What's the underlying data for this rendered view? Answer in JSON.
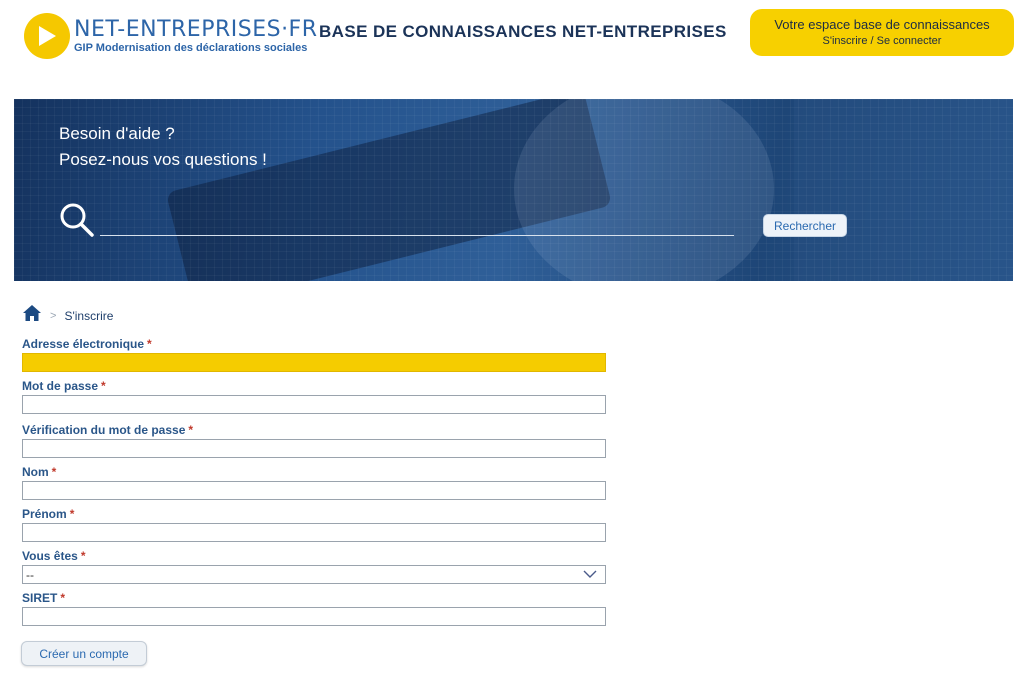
{
  "header": {
    "logo_main": "NET-ENTREPRISES·FR",
    "logo_sub": "GIP Modernisation des déclarations sociales",
    "site_title": "BASE DE CONNAISSANCES NET-ENTREPRISES",
    "account_title": "Votre espace base de connaissances",
    "register_link": "S'inscrire",
    "separator": "/",
    "login_link": "Se connecter",
    "accent_color": "#f7d000"
  },
  "banner": {
    "line1": "Besoin d'aide ?",
    "line2": "Posez-nous vos questions !",
    "search_value": "",
    "search_button": "Rechercher"
  },
  "breadcrumb": {
    "home_icon": "home-icon",
    "separator": ">",
    "current": "S'inscrire"
  },
  "form": {
    "required_mark": "*",
    "email_label": "Adresse électronique",
    "password_label": "Mot de passe",
    "password_confirm_label": "Vérification du mot de passe",
    "lastname_label": "Nom",
    "firstname_label": "Prénom",
    "role_label": "Vous êtes",
    "role_value": "--",
    "siret_label": "SIRET",
    "submit_label": "Créer un compte"
  }
}
